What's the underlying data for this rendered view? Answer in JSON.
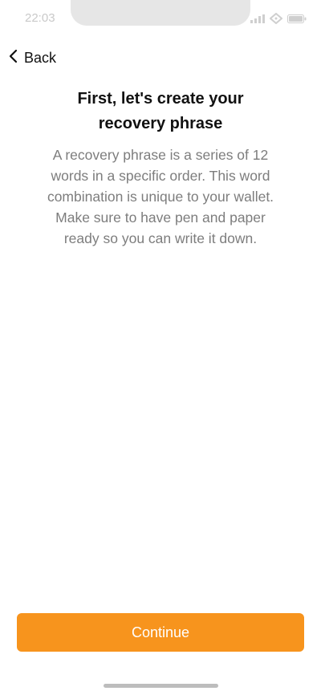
{
  "status_bar": {
    "time": "22:03",
    "icons": [
      "signal-icon",
      "wifi-icon",
      "battery-icon"
    ]
  },
  "nav": {
    "back_label": "Back",
    "back_icon": "chevron-left-icon"
  },
  "content": {
    "title_line1": "First, let's create your",
    "title_line2": "recovery phrase",
    "description_lines": [
      "A recovery phrase is a series of 12",
      "words in a specific order. This word",
      "combination is unique to your wallet.",
      "Make sure to have pen and paper",
      "ready so you can write it down."
    ]
  },
  "actions": {
    "continue_label": "Continue"
  },
  "colors": {
    "accent": "#f7941d",
    "title": "#111111",
    "description": "#7d7d7d",
    "background": "#ffffff"
  }
}
